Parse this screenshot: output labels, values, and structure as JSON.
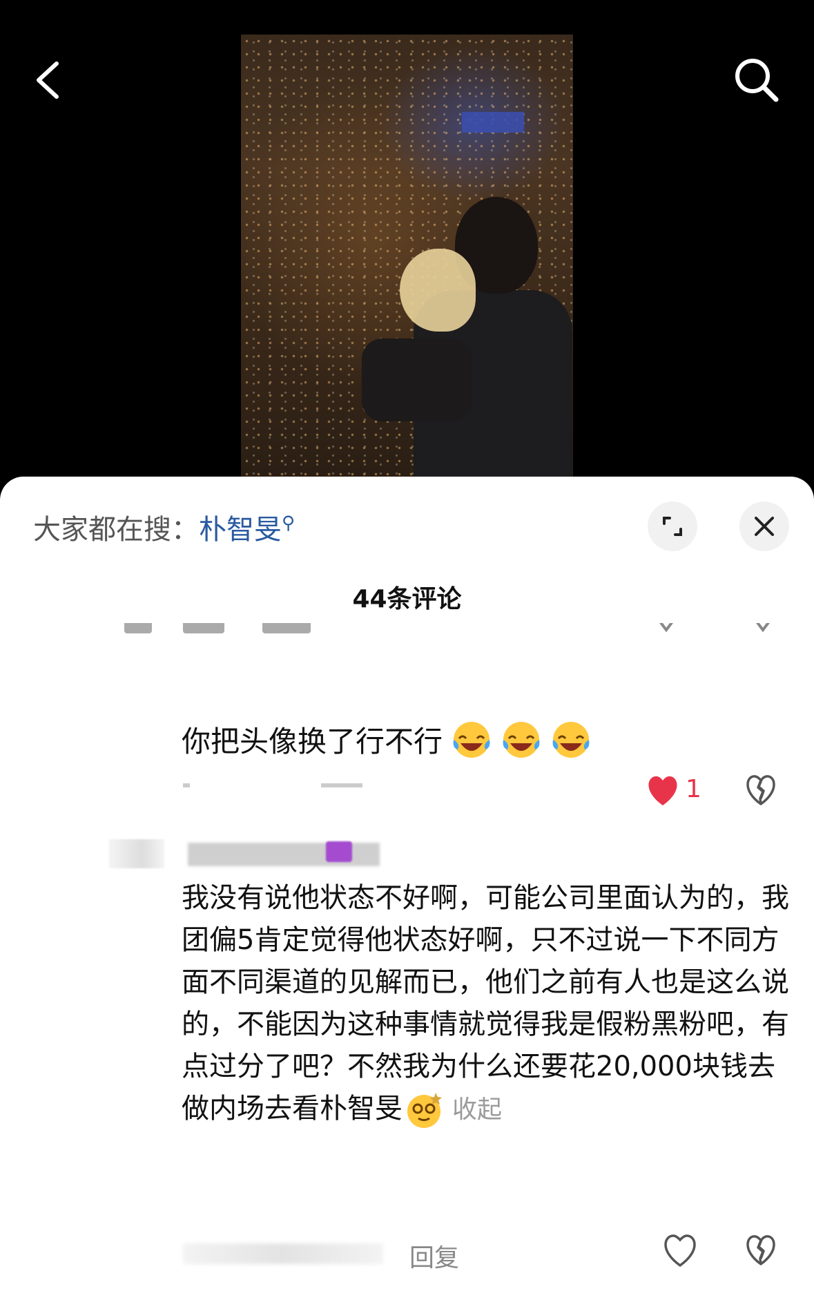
{
  "nav": {
    "back_icon": "chevron-left-icon",
    "search_icon": "search-icon"
  },
  "search_hint": {
    "prefix": "大家都在搜：",
    "term": "朴智旻"
  },
  "comments": {
    "count_label": "44条评论",
    "reply": {
      "text": "你把头像换了行不行",
      "emoji": "face-with-tears-of-joy",
      "emoji_count": 3,
      "likes": "1",
      "liked": true
    },
    "main": {
      "text": "我没有说他状态不好啊，可能公司里面认为的，我团偏5肯定觉得他状态好啊，只不过说一下不同方面不同渠道的见解而已，他们之前有人也是这么说的，不能因为这种事情就觉得我是假粉黑粉吧，有点过分了吧？不然我为什么还要花20,000块钱去做内场去看朴智旻",
      "collapse_label": "收起",
      "reply_label": "回复"
    }
  },
  "colors": {
    "like_red": "#e8344a",
    "link_blue": "#2a5aa0",
    "name_badge": "#a44bd0"
  }
}
